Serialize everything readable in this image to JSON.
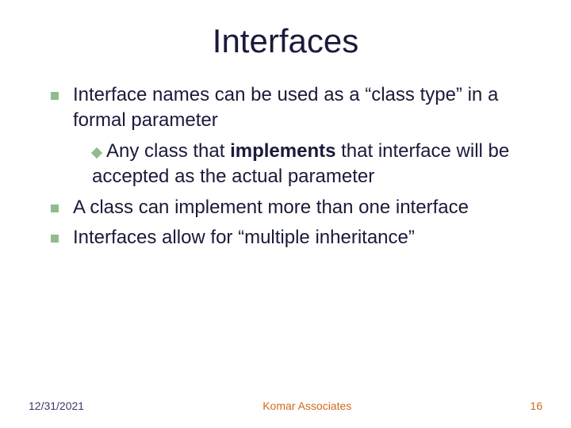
{
  "title": "Interfaces",
  "bullets": {
    "b1": "Interface names can be used as a “class type” in a formal parameter",
    "b1_sub_pre": "Any class that ",
    "b1_sub_bold": "implements",
    "b1_sub_post": " that interface will be accepted as the actual parameter",
    "b2": "A class can implement more than one interface",
    "b3": "Interfaces allow for “multiple inheritance”"
  },
  "footer": {
    "date": "12/31/2021",
    "org": "Komar Associates",
    "page": "16"
  }
}
